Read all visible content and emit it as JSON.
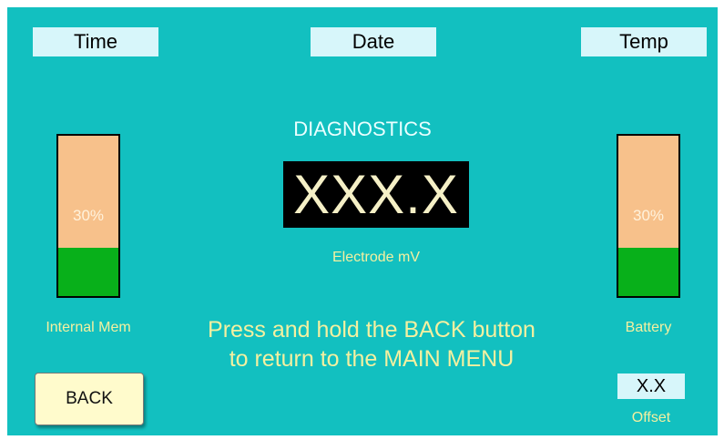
{
  "header": {
    "time_label": "Time",
    "date_label": "Date",
    "temp_label": "Temp"
  },
  "main": {
    "title": "DIAGNOSTICS",
    "readout_value": "XXX.X",
    "readout_label": "Electrode mV",
    "message_line1": "Press and hold the BACK button",
    "message_line2": "to return to the MAIN MENU"
  },
  "gauges": {
    "internal_mem": {
      "label": "Internal Mem",
      "percent_text": "30%",
      "level": 0.3
    },
    "battery": {
      "label": "Battery",
      "percent_text": "30%",
      "level": 0.3
    }
  },
  "footer": {
    "back_label": "BACK",
    "offset_value": "X.X",
    "offset_label": "Offset"
  },
  "colors": {
    "background": "#12c0c0",
    "gauge_empty": "#f7c18b",
    "gauge_fill": "#08b01a",
    "label_text": "#f4f0a0"
  }
}
